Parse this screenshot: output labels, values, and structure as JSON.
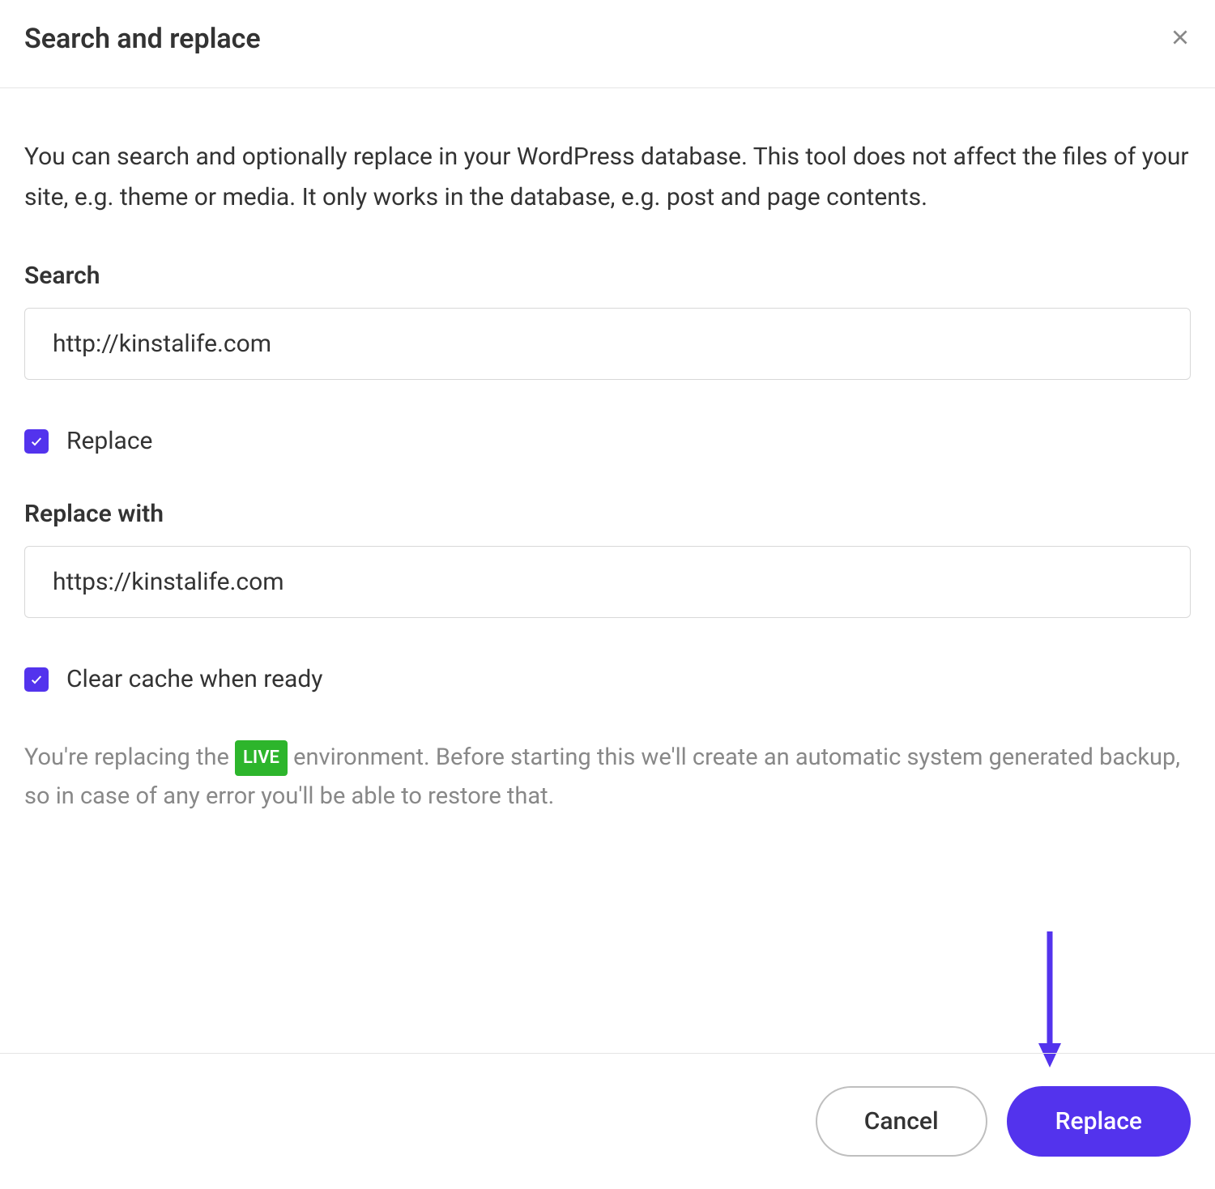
{
  "dialog": {
    "title": "Search and replace",
    "intro": "You can search and optionally replace in your WordPress database. This tool does not affect the files of your site, e.g. theme or media. It only works in the database, e.g. post and page contents."
  },
  "search": {
    "label": "Search",
    "value": "http://kinstalife.com"
  },
  "replaceCheckbox": {
    "label": "Replace",
    "checked": true
  },
  "replaceWith": {
    "label": "Replace with",
    "value": "https://kinstalife.com"
  },
  "clearCache": {
    "label": "Clear cache when ready",
    "checked": true
  },
  "note": {
    "before": "You're replacing the ",
    "badge": "LIVE",
    "after": " environment. Before starting this we'll create an automatic system generated backup, so in case of any error you'll be able to restore that."
  },
  "footer": {
    "cancel": "Cancel",
    "replace": "Replace"
  }
}
